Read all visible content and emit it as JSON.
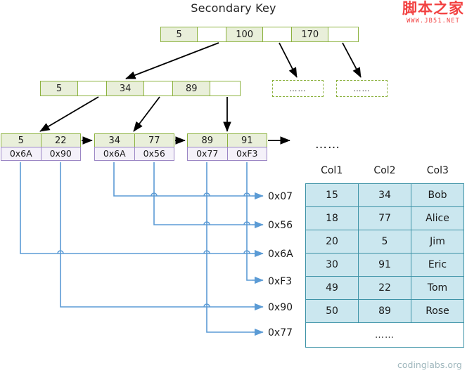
{
  "title": "Secondary Key",
  "colors": {
    "index_border": "#8cb23f",
    "index_fill": "#e9efda",
    "pointer_border": "#9b86c4",
    "pointer_fill": "#f4f1f9",
    "table_border": "#3e93a7",
    "table_fill": "#cbe7ef",
    "connector": "#5b9bd5",
    "arrow": "#000000",
    "watermark_red": "#f24141"
  },
  "tree": {
    "root": {
      "cells": [
        {
          "label": "5",
          "empty": false
        },
        {
          "label": "",
          "empty": true
        },
        {
          "label": "100",
          "empty": false
        },
        {
          "label": "",
          "empty": true
        },
        {
          "label": "170",
          "empty": false
        },
        {
          "label": "",
          "empty": true
        }
      ]
    },
    "internal": {
      "cells": [
        {
          "label": "5",
          "empty": false
        },
        {
          "label": "",
          "empty": true
        },
        {
          "label": "34",
          "empty": false
        },
        {
          "label": "",
          "empty": true
        },
        {
          "label": "89",
          "empty": false
        },
        {
          "label": "",
          "empty": true
        }
      ]
    },
    "placeholders": [
      {
        "label": "……"
      },
      {
        "label": "……"
      }
    ],
    "leaves": [
      {
        "keys": [
          "5",
          "22"
        ],
        "pointers": [
          "0x6A",
          "0x90"
        ]
      },
      {
        "keys": [
          "34",
          "77"
        ],
        "pointers": [
          "0x6A",
          "0x56"
        ]
      },
      {
        "keys": [
          "89",
          "91"
        ],
        "pointers": [
          "0x77",
          "0xF3"
        ]
      }
    ],
    "leaf_ellipsis": "……"
  },
  "addresses": [
    {
      "label": "0x07"
    },
    {
      "label": "0x56"
    },
    {
      "label": "0x6A"
    },
    {
      "label": "0xF3"
    },
    {
      "label": "0x90"
    },
    {
      "label": "0x77"
    }
  ],
  "table": {
    "headers": [
      "Col1",
      "Col2",
      "Col3"
    ],
    "rows": [
      [
        "15",
        "34",
        "Bob"
      ],
      [
        "18",
        "77",
        "Alice"
      ],
      [
        "20",
        "5",
        "Jim"
      ],
      [
        "30",
        "91",
        "Eric"
      ],
      [
        "49",
        "22",
        "Tom"
      ],
      [
        "50",
        "89",
        "Rose"
      ]
    ],
    "footer": "……"
  },
  "watermarks": {
    "jb51_cn": "脚本之家",
    "jb51_url": "WWW.JB51.NET",
    "codinglabs": "codinglabs.org"
  }
}
